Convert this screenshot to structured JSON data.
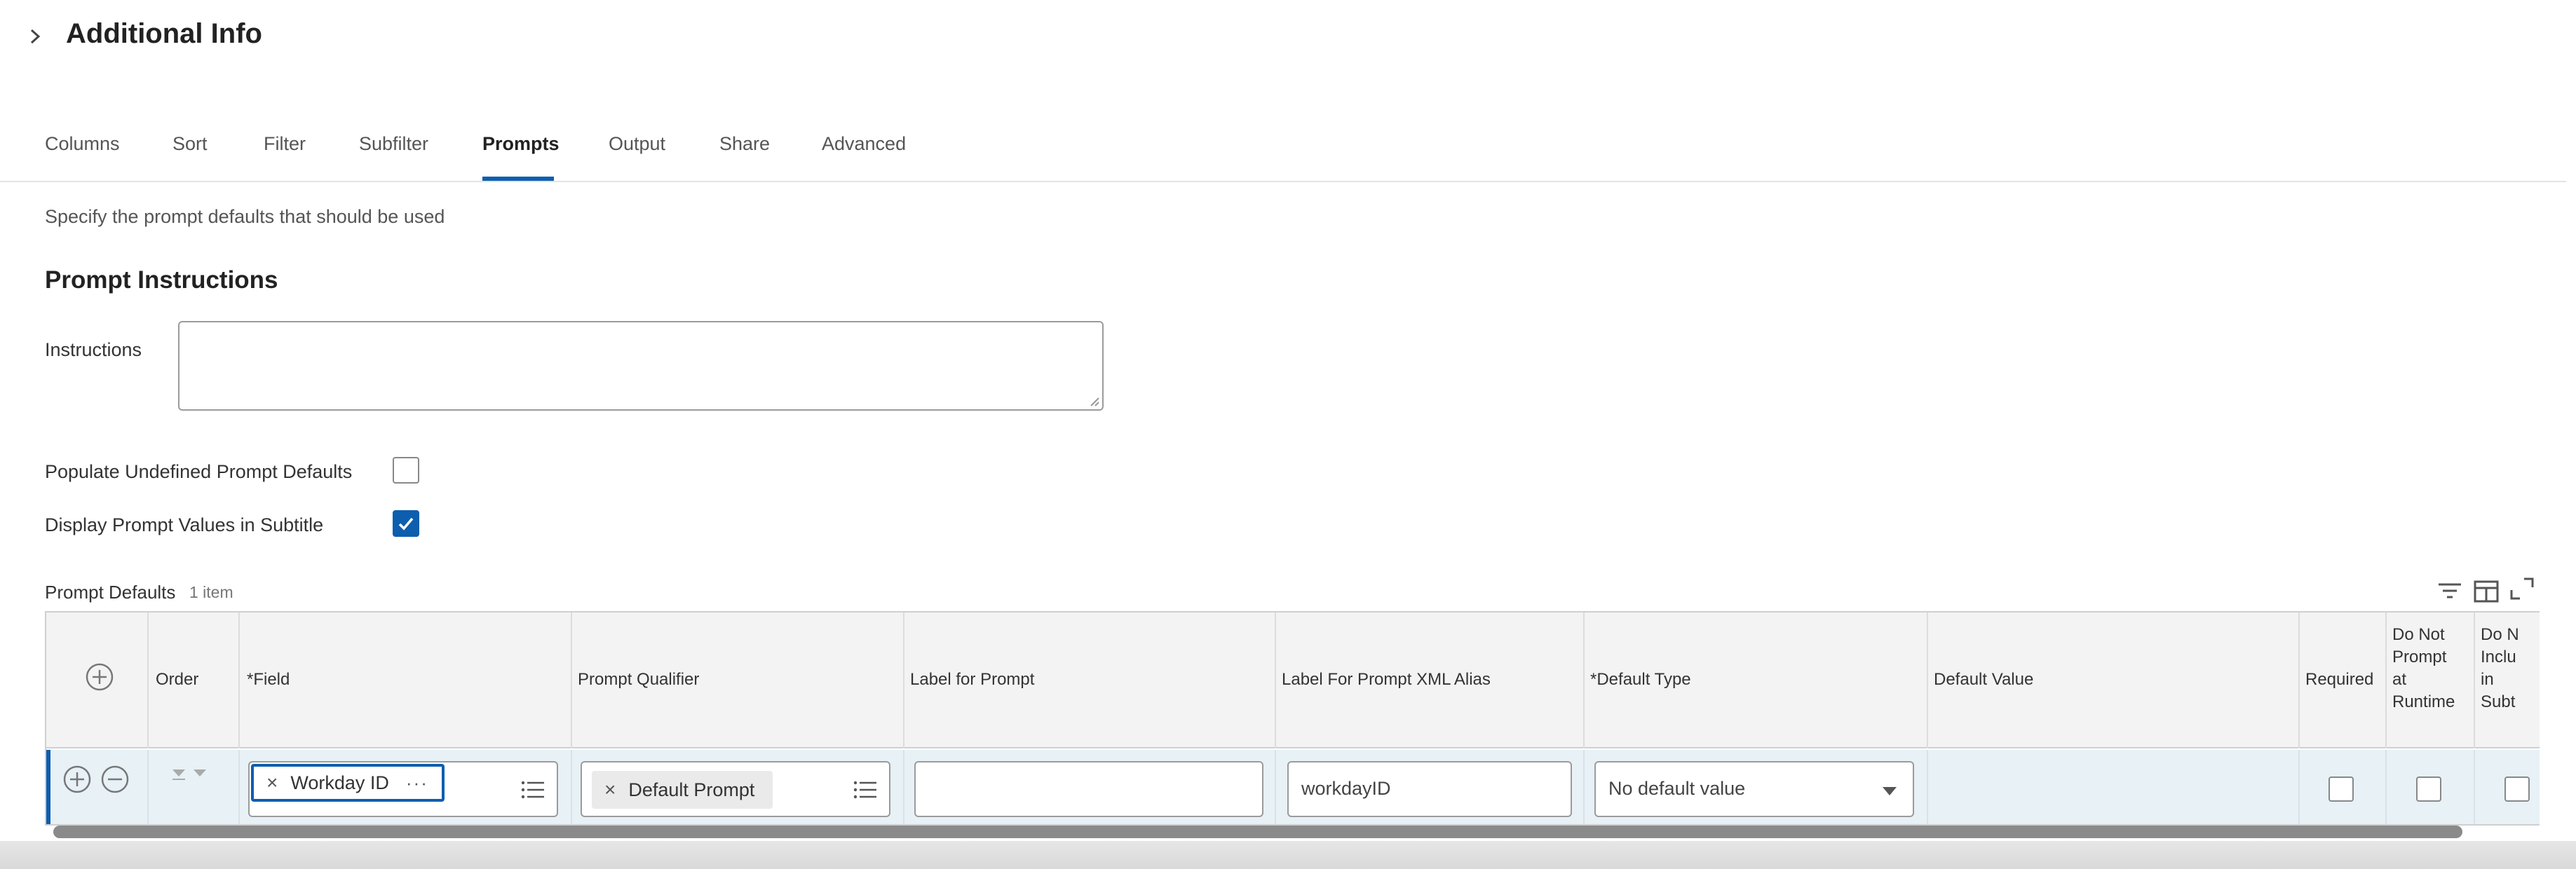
{
  "header": {
    "title": "Additional Info"
  },
  "tabs": [
    {
      "label": "Columns"
    },
    {
      "label": "Sort"
    },
    {
      "label": "Filter"
    },
    {
      "label": "Subfilter"
    },
    {
      "label": "Prompts"
    },
    {
      "label": "Output"
    },
    {
      "label": "Share"
    },
    {
      "label": "Advanced"
    }
  ],
  "active_tab": "Prompts",
  "subtitle": "Specify the prompt defaults that should be used",
  "prompt_instructions": {
    "heading": "Prompt Instructions",
    "instructions_label": "Instructions",
    "instructions_value": ""
  },
  "options": {
    "populate_label": "Populate Undefined Prompt Defaults",
    "populate_checked": false,
    "display_label": "Display Prompt Values in Subtitle",
    "display_checked": true
  },
  "prompt_defaults": {
    "label": "Prompt Defaults",
    "count": "1 item",
    "columns": {
      "order": "Order",
      "field": "*Field",
      "qualifier": "Prompt Qualifier",
      "label_prompt": "Label for Prompt",
      "xml_alias": "Label For Prompt XML Alias",
      "default_type": "*Default Type",
      "default_value": "Default Value",
      "required": "Required",
      "not_prompt": [
        "Do Not",
        "Prompt",
        "at",
        "Runtime"
      ],
      "not_include": [
        "Do N",
        "Inclu",
        "in",
        "Subt"
      ]
    },
    "row": {
      "field_value": "Workday ID",
      "qualifier_value": "Default Prompt",
      "label_prompt_value": "",
      "xml_alias_value": "workdayID",
      "default_type_value": "No default value",
      "required": false,
      "not_prompt": false,
      "not_include": false
    }
  },
  "icons": {
    "chevron": "chevron-right-icon",
    "add": "plus-circle-icon",
    "remove": "minus-circle-icon",
    "filter": "filter-icon",
    "columns": "columns-icon",
    "expand": "expand-icon",
    "list": "list-icon",
    "close": "close-icon",
    "more": "more-icon",
    "dropdown": "caret-down-icon"
  },
  "colors": {
    "accent": "#0d5eaf",
    "row_highlight": "#e7f1f6",
    "header_bg": "#f3f3f3"
  }
}
